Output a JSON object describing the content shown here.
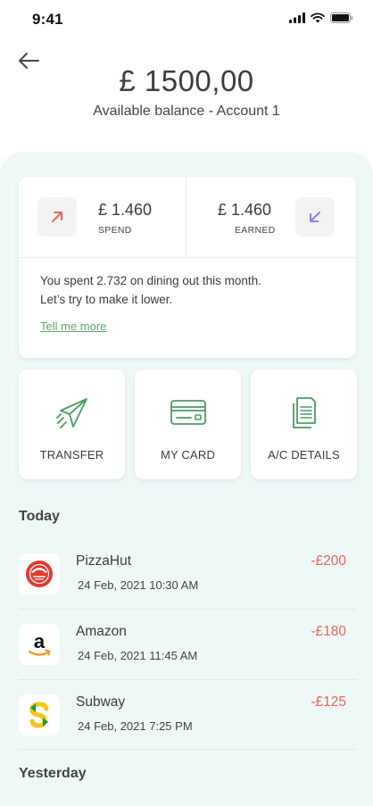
{
  "status_bar": {
    "time": "9:41"
  },
  "header": {
    "balance": "£ 1500,00",
    "subtitle": "Available balance - Account 1"
  },
  "summary": {
    "spend": {
      "amount": "£ 1.460",
      "label": "SPEND",
      "icon": "arrow-up-right-icon",
      "color": "#e5655a"
    },
    "earned": {
      "amount": "£ 1.460",
      "label": "EARNED",
      "icon": "arrow-down-left-icon",
      "color": "#8b7cf0"
    },
    "tip_line1": "You spent 2.732 on dining out this month.",
    "tip_line2": "Let’s try to make it lower.",
    "link": "Tell me more"
  },
  "actions": [
    {
      "label": "TRANSFER",
      "icon": "paper-plane-icon"
    },
    {
      "label": "MY CARD",
      "icon": "credit-card-icon"
    },
    {
      "label": "A/C DETAILS",
      "icon": "documents-icon"
    }
  ],
  "sections": {
    "today": "Today",
    "yesterday": "Yesterday"
  },
  "transactions": [
    {
      "name": "PizzaHut",
      "date": "24 Feb, 2021 10:30 AM",
      "amount": "-£200",
      "icon": "pizzahut-logo-icon"
    },
    {
      "name": "Amazon",
      "date": "24 Feb, 2021 11:45 AM",
      "amount": "-£180",
      "icon": "amazon-logo-icon"
    },
    {
      "name": "Subway",
      "date": "24 Feb, 2021 7:25 PM",
      "amount": "-£125",
      "icon": "subway-logo-icon"
    }
  ],
  "colors": {
    "accent_green": "#5aa86a",
    "negative": "#e5655a",
    "panel_bg": "#eef8f7"
  }
}
